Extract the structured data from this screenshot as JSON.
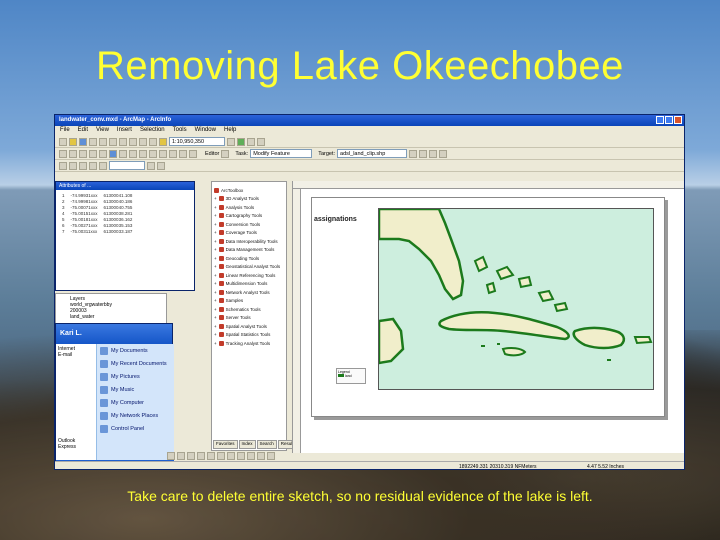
{
  "slide": {
    "title": "Removing Lake Okeechobee",
    "caption": "Take care to delete entire sketch, so no residual evidence of the lake is left."
  },
  "window": {
    "title": "landwater_conv.mxd - ArcMap - ArcInfo",
    "menu": [
      "File",
      "Edit",
      "View",
      "Insert",
      "Selection",
      "Tools",
      "Window",
      "Help"
    ],
    "scale": "1:10,950,350",
    "task_label": "Task:",
    "task_value": "Modify Feature",
    "target_label": "Target:",
    "target_value": "adsl_land_clip.shp",
    "editor_label": "Editor"
  },
  "attribute_table": {
    "title": "Attributes of ...",
    "rows": [
      [
        "1",
        "-74.99931xxx",
        "61300041.108"
      ],
      [
        "2",
        "-74.99981xxx",
        "61300040.186"
      ],
      [
        "3",
        "-75.00071xxx",
        "61300040.755"
      ],
      [
        "4",
        "-75.00151xxx",
        "61300038.281"
      ],
      [
        "5",
        "-75.00181xxx",
        "61300036.162"
      ],
      [
        "6",
        "-75.00271xxx",
        "61300035.153"
      ],
      [
        "7",
        "-75.00311xxx",
        "61300033.187"
      ]
    ]
  },
  "toc": {
    "items": [
      "Layers",
      "world_vrgwaterbby",
      "200003",
      "land_water"
    ]
  },
  "start_menu": {
    "user": "Kari L.",
    "left_items": [
      "Internet",
      "E-mail",
      "Outlook Express"
    ],
    "right_items": [
      "My Documents",
      "My Recent Documents",
      "My Pictures",
      "My Music",
      "My Computer",
      "My Network Places",
      "Control Panel"
    ]
  },
  "toolbox": {
    "root": "ArcToolbox",
    "items": [
      "3D Analyst Tools",
      "Analysis Tools",
      "Cartography Tools",
      "Conversion Tools",
      "Coverage Tools",
      "Data Interoperability Tools",
      "Data Management Tools",
      "Geocoding Tools",
      "Geostatistical Analyst Tools",
      "Linear Referencing Tools",
      "Multidimension Tools",
      "Network Analyst Tools",
      "Samples",
      "Schematics Tools",
      "Server Tools",
      "Spatial Analyst Tools",
      "Spatial Statistics Tools",
      "Tracking Analyst Tools"
    ],
    "tabs": [
      "Favorites",
      "Index",
      "Search",
      "Results"
    ]
  },
  "layout": {
    "map_title": "assignations",
    "legend_title": "Legend",
    "legend_item": "land"
  },
  "status": {
    "coordinates": "1892249.331  20310.319 NFMeters",
    "units": "4.47  5.52 Inches"
  },
  "colors": {
    "title_yellow": "#ffff33",
    "land_fill": "#f1eecb",
    "land_stroke": "#1c7a1c",
    "water_fill": "#cdeede"
  }
}
